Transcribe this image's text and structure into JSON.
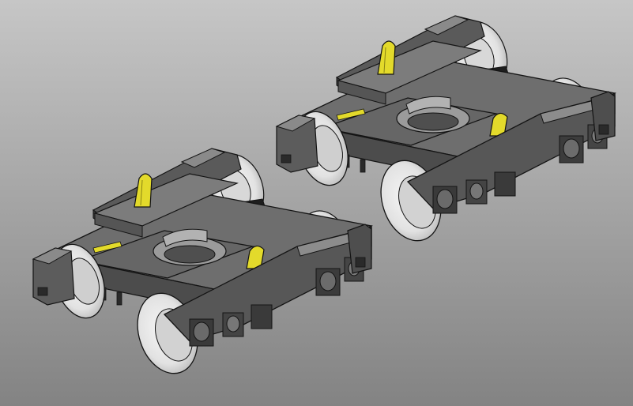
{
  "viewport": {
    "background_top": "#c6c6c6",
    "background_bottom": "#838383"
  },
  "scene": {
    "objects": [
      "bogie",
      "bogie"
    ],
    "body_color": "#6a6a6a",
    "body_light_color": "#8c8c8c",
    "body_dark_color": "#3c3c3c",
    "edge_color": "#141414",
    "wheel_color": "#e9e9e9",
    "accent_color": "#e3da2b"
  }
}
